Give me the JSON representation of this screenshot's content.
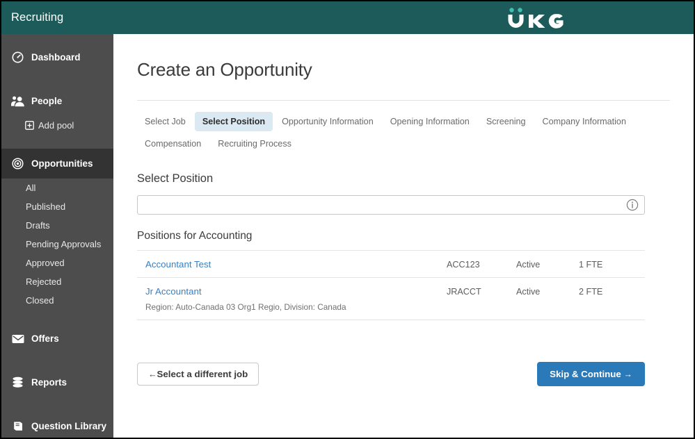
{
  "header": {
    "title": "Recruiting",
    "logo_text": "UKG",
    "logo_name": "ukg-logo",
    "background_color": "#1d5b5a"
  },
  "sidebar": {
    "background_color": "#4d4d4d",
    "active_background_color": "#333333",
    "items": [
      {
        "label": "Dashboard",
        "icon": "dashboard-icon",
        "active": false
      },
      {
        "label": "People",
        "icon": "people-icon",
        "active": false
      },
      {
        "label": "Add pool",
        "icon": "plus-box-icon",
        "sub": true
      },
      {
        "label": "Opportunities",
        "icon": "target-icon",
        "active": true
      },
      {
        "label": "All",
        "sub": true
      },
      {
        "label": "Published",
        "sub": true
      },
      {
        "label": "Drafts",
        "sub": true
      },
      {
        "label": "Pending Approvals",
        "sub": true
      },
      {
        "label": "Approved",
        "sub": true
      },
      {
        "label": "Rejected",
        "sub": true
      },
      {
        "label": "Closed",
        "sub": true
      },
      {
        "label": "Offers",
        "icon": "envelope-icon",
        "active": false
      },
      {
        "label": "Reports",
        "icon": "database-icon",
        "active": false
      },
      {
        "label": "Question Library",
        "icon": "book-icon",
        "active": false
      }
    ]
  },
  "main": {
    "page_title": "Create an Opportunity",
    "tabs": [
      {
        "label": "Select Job",
        "active": false
      },
      {
        "label": "Select Position",
        "active": true
      },
      {
        "label": "Opportunity Information",
        "active": false
      },
      {
        "label": "Opening Information",
        "active": false
      },
      {
        "label": "Screening",
        "active": false
      },
      {
        "label": "Company Information",
        "active": false
      },
      {
        "label": "Compensation",
        "active": false
      },
      {
        "label": "Recruiting Process",
        "active": false
      }
    ],
    "section_title": "Select Position",
    "search": {
      "value": "",
      "placeholder": "",
      "info_icon": "info-circle-icon"
    },
    "list_title": "Positions for Accounting",
    "positions": [
      {
        "name": "Accountant Test",
        "code": "ACC123",
        "status": "Active",
        "fte": "1 FTE",
        "details": ""
      },
      {
        "name": "Jr Accountant",
        "code": "JRACCT",
        "status": "Active",
        "fte": "2 FTE",
        "details": "Region: Auto-Canada 03 Org1 Regio, Division: Canada"
      }
    ],
    "footer": {
      "back_label": "Select a different job",
      "back_arrow": "←",
      "continue_label": "Skip & Continue",
      "continue_arrow": "→",
      "primary_color": "#2a7ab9"
    }
  }
}
